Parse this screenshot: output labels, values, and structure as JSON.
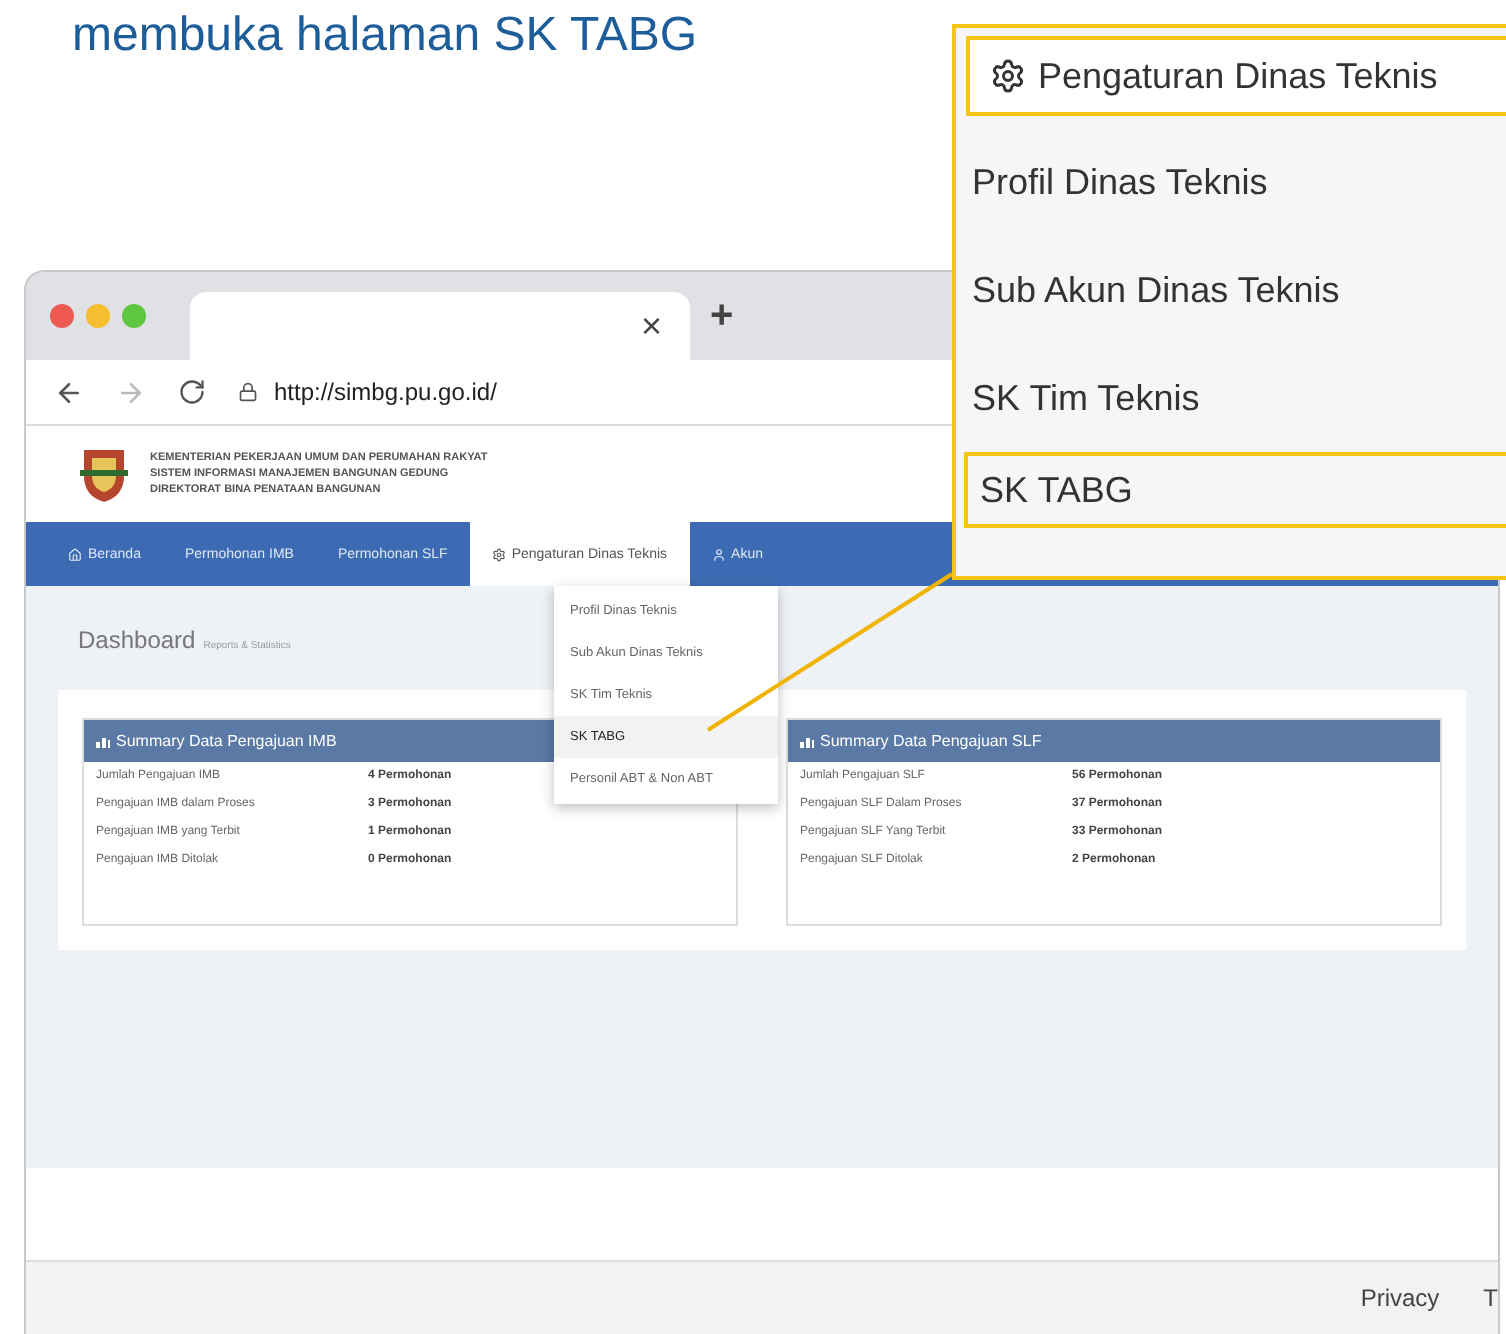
{
  "heading": "membuka halaman SK TABG",
  "browser": {
    "tab_close": "×",
    "new_tab": "+",
    "url": "http://simbg.pu.go.id/"
  },
  "site_header": {
    "lines": [
      "KEMENTERIAN PEKERJAAN UMUM DAN PERUMAHAN RAKYAT",
      "SISTEM INFORMASI MANAJEMEN BANGUNAN GEDUNG",
      "DIREKTORAT BINA PENATAAN BANGUNAN"
    ]
  },
  "nav": [
    {
      "label": "Beranda",
      "kind": "home",
      "selected": false
    },
    {
      "label": "Permohonan IMB",
      "kind": "plain",
      "selected": false
    },
    {
      "label": "Permohonan SLF",
      "kind": "plain",
      "selected": false
    },
    {
      "label": "Pengaturan Dinas Teknis",
      "kind": "settings",
      "selected": true
    },
    {
      "label": "Akun",
      "kind": "user",
      "selected": false
    }
  ],
  "dropdown": [
    {
      "label": "Profil Dinas Teknis",
      "selected": false
    },
    {
      "label": "Sub Akun Dinas Teknis",
      "selected": false
    },
    {
      "label": "SK Tim Teknis",
      "selected": false
    },
    {
      "label": "SK TABG",
      "selected": true
    },
    {
      "label": "Personil ABT & Non ABT",
      "selected": false
    }
  ],
  "page": {
    "title": "Dashboard",
    "subtitle": "Reports & Statistics"
  },
  "panels": [
    {
      "title": "Summary Data Pengajuan IMB",
      "rows": [
        [
          "Jumlah Pengajuan IMB",
          "4 Permohonan"
        ],
        [
          "Pengajuan IMB dalam Proses",
          "3 Permohonan"
        ],
        [
          "Pengajuan IMB yang Terbit",
          "1 Permohonan"
        ],
        [
          "Pengajuan IMB Ditolak",
          "0 Permohonan"
        ]
      ]
    },
    {
      "title": "Summary Data Pengajuan SLF",
      "rows": [
        [
          "Jumlah Pengajuan SLF",
          "56 Permohonan"
        ],
        [
          "Pengajuan SLF Dalam Proses",
          "37 Permohonan"
        ],
        [
          "Pengajuan SLF Yang Terbit",
          "33 Permohonan"
        ],
        [
          "Pengajuan SLF Ditolak",
          "2 Permohonan"
        ]
      ]
    }
  ],
  "footer": {
    "links": [
      "Privacy",
      "T"
    ]
  },
  "callout": {
    "title": "Pengaturan Dinas Teknis",
    "items": [
      {
        "label": "Profil Dinas Teknis",
        "selected": false
      },
      {
        "label": "Sub Akun Dinas Teknis",
        "selected": false
      },
      {
        "label": "SK Tim Teknis",
        "selected": false
      },
      {
        "label": "SK TABG",
        "selected": true
      }
    ]
  }
}
